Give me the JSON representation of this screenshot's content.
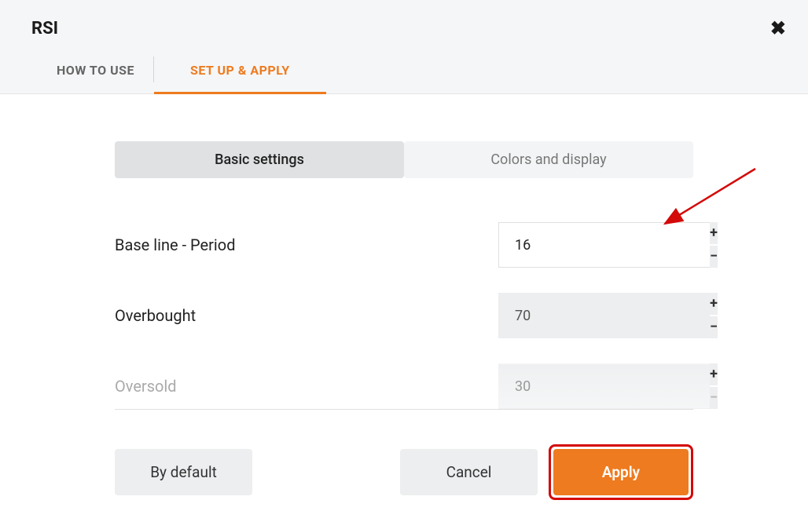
{
  "header": {
    "title": "RSI"
  },
  "tabs": {
    "how_to_use": "HOW TO USE",
    "set_up_apply": "SET UP & APPLY"
  },
  "sub_tabs": {
    "basic": "Basic settings",
    "colors": "Colors and display"
  },
  "fields": {
    "baseline": {
      "label": "Base line - Period",
      "value": "16"
    },
    "overbought": {
      "label": "Overbought",
      "value": "70"
    },
    "oversold": {
      "label": "Oversold",
      "value": "30"
    }
  },
  "actions": {
    "default": "By default",
    "cancel": "Cancel",
    "apply": "Apply"
  },
  "colors": {
    "accent": "#ee7b1f",
    "highlight": "#d40909"
  }
}
